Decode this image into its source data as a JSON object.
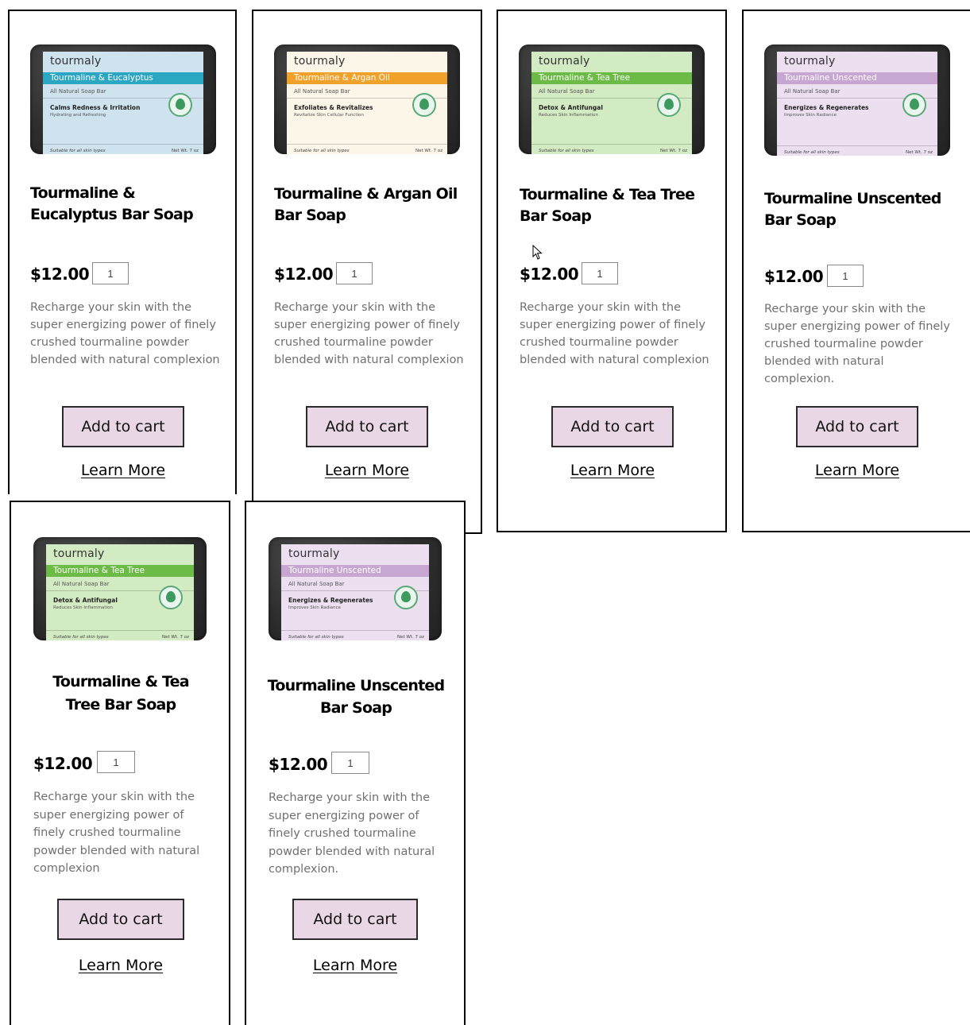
{
  "products": [
    {
      "label": {
        "brand": "tourmaly",
        "band": "Tourmaline & Eucalyptus",
        "sub": "All Natural Soap Bar",
        "benefit": "Calms Redness & Irritation",
        "benefit_sub": "Hydrating and Refreshing",
        "footer": "Suitable for all skin types",
        "net": "Net Wt. 7 oz",
        "band_color": "#2ba6c3",
        "bg_color": "#cfe3ef"
      },
      "title": "Tourmaline & Eucalyptus Bar Soap",
      "price": "$12.00",
      "qty": "1",
      "description": "Recharge your skin with the super energizing power of finely crushed tourmaline powder blended with natural complexion",
      "add_to_cart": "Add to cart",
      "learn_more": "Learn More"
    },
    {
      "label": {
        "brand": "tourmaly",
        "band": "Tourmaline & Argan Oil",
        "sub": "All Natural Soap Bar",
        "benefit": "Exfoliates & Revitalizes",
        "benefit_sub": "Revitalize Skin Cellular Function",
        "footer": "Suitable for all skin types",
        "net": "Net Wt. 7 oz",
        "band_color": "#f0a12a",
        "bg_color": "#fbf6e8"
      },
      "title": "Tourmaline & Argan Oil Bar Soap",
      "price": "$12.00",
      "qty": "1",
      "description": "Recharge your skin with the super energizing power of finely crushed tourmaline powder blended with natural complexion",
      "add_to_cart": "Add to cart",
      "learn_more": "Learn More"
    },
    {
      "label": {
        "brand": "tourmaly",
        "band": "Tourmaline & Tea Tree",
        "sub": "All Natural Soap Bar",
        "benefit": "Detox & Antifungal",
        "benefit_sub": "Reduces Skin Inflammation",
        "footer": "Suitable for all skin types",
        "net": "Net Wt. 7 oz",
        "band_color": "#6cbb46",
        "bg_color": "#d3ebc2"
      },
      "title": "Tourmaline & Tea Tree Bar Soap",
      "price": "$12.00",
      "qty": "1",
      "description": "Recharge your skin with the super energizing power of finely crushed tourmaline powder blended with natural complexion",
      "add_to_cart": "Add to cart",
      "learn_more": "Learn More"
    },
    {
      "label": {
        "brand": "tourmaly",
        "band": "Tourmaline Unscented",
        "sub": "All Natural Soap Bar",
        "benefit": "Energizes & Regenerates",
        "benefit_sub": "Improves Skin Radiance",
        "footer": "Suitable for all skin types",
        "net": "Net Wt. 7 oz",
        "band_color": "#c7a7d1",
        "bg_color": "#ecdff0"
      },
      "title": "Tourmaline Unscented Bar Soap",
      "price": "$12.00",
      "qty": "1",
      "description": "Recharge your skin with the super energizing power of finely crushed tourmaline powder blended with natural complexion.",
      "add_to_cart": "Add to cart",
      "learn_more": "Learn More"
    },
    {
      "label": {
        "brand": "tourmaly",
        "band": "Tourmaline & Tea Tree",
        "sub": "All Natural Soap Bar",
        "benefit": "Detox & Antifungal",
        "benefit_sub": "Reduces Skin Inflammation",
        "footer": "Suitable for all skin types",
        "net": "Net Wt. 7 oz",
        "band_color": "#6cbb46",
        "bg_color": "#d3ebc2"
      },
      "title": "Tourmaline & Tea Tree Bar Soap",
      "price": "$12.00",
      "qty": "1",
      "description": "Recharge your skin with the super energizing power of finely crushed tourmaline powder blended with natural complexion",
      "add_to_cart": "Add to cart",
      "learn_more": "Learn More"
    },
    {
      "label": {
        "brand": "tourmaly",
        "band": "Tourmaline Unscented",
        "sub": "All Natural Soap Bar",
        "benefit": "Energizes & Regenerates",
        "benefit_sub": "Improves Skin Radiance",
        "footer": "Suitable for all skin types",
        "net": "Net Wt. 7 oz",
        "band_color": "#c7a7d1",
        "bg_color": "#ecdff0"
      },
      "title": "Tourmaline Unscented Bar Soap",
      "price": "$12.00",
      "qty": "1",
      "description": "Recharge your skin with the super energizing power of finely crushed tourmaline powder blended with natural complexion.",
      "add_to_cart": "Add to cart",
      "learn_more": "Learn More"
    }
  ]
}
